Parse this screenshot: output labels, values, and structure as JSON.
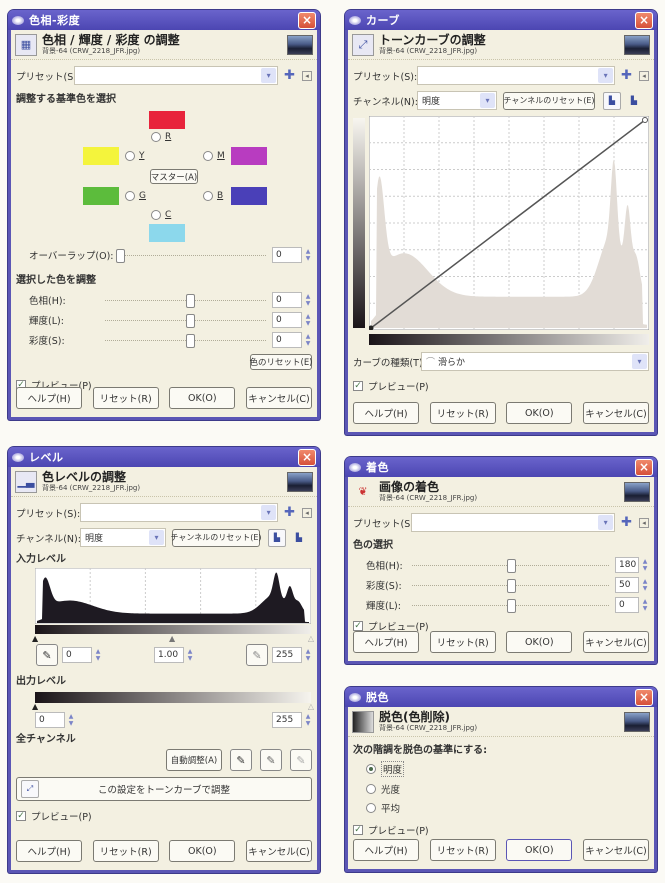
{
  "common": {
    "subtitle": "背景-64 (CRW_2218_JFR.jpg)",
    "preset_label": "プリセット(S):",
    "preset_value": "",
    "preview_label": "プレビュー(P)",
    "preview_checked": true,
    "buttons": {
      "help": "ヘルプ(H)",
      "reset": "リセット(R)",
      "ok": "OK(O)",
      "cancel": "キャンセル(C)"
    },
    "icons": {
      "close": "×",
      "dropdown": "▾",
      "add_preset": "✚",
      "menu": "◂",
      "checkmark": "✓",
      "spin_arrows": "▲▼"
    }
  },
  "hue_saturation": {
    "window_title": "色相-彩度",
    "header_title": "色相 / 輝度 / 彩度 の調整",
    "select_color_section": "調整する基準色を選択",
    "colors": {
      "R": {
        "label": "R",
        "color": "#e8243c"
      },
      "Y": {
        "label": "Y",
        "color": "#f4f43c"
      },
      "M": {
        "label": "M",
        "color": "#b83cc0"
      },
      "G": {
        "label": "G",
        "color": "#5cbc3c"
      },
      "B": {
        "label": "B",
        "color": "#4a40b8"
      },
      "C": {
        "label": "C",
        "color": "#8cd8ec"
      }
    },
    "master_button": "マスター(A)",
    "overlap_label": "オーバーラップ(O):",
    "overlap_value": "0",
    "adjust_section": "選択した色を調整",
    "sliders": [
      {
        "label": "色相(H):",
        "value": "0"
      },
      {
        "label": "輝度(L):",
        "value": "0"
      },
      {
        "label": "彩度(S):",
        "value": "0"
      }
    ],
    "reset_color_button": "色のリセット(E)"
  },
  "curves": {
    "window_title": "カーブ",
    "header_title": "トーンカーブの調整",
    "channel_label": "チャンネル(N):",
    "channel_value": "明度",
    "reset_channel_button": "チャンネルのリセット(E)",
    "curve_type_label": "カーブの種類(T):",
    "curve_type_value": "滑らか"
  },
  "levels": {
    "window_title": "レベル",
    "header_title": "色レベルの調整",
    "channel_label": "チャンネル(N):",
    "channel_value": "明度",
    "reset_channel_button": "チャンネルのリセット(E)",
    "input_section": "入力レベル",
    "input_low": "0",
    "input_gamma": "1.00",
    "input_high": "255",
    "output_section": "出力レベル",
    "output_low": "0",
    "output_high": "255",
    "all_channels_section": "全チャンネル",
    "auto_button": "自動調整(A)",
    "edit_curves_button": "この設定をトーンカーブで調整"
  },
  "colorize": {
    "window_title": "着色",
    "header_title": "画像の着色",
    "select_section": "色の選択",
    "sliders": [
      {
        "label": "色相(H):",
        "value": "180",
        "fraction": 0.5
      },
      {
        "label": "彩度(S):",
        "value": "50",
        "fraction": 0.5
      },
      {
        "label": "輝度(L):",
        "value": "0",
        "fraction": 0.5
      }
    ]
  },
  "desaturate": {
    "window_title": "脱色",
    "header_title": "脱色(色削除)",
    "section": "次の階調を脱色の基準にする:",
    "options": [
      {
        "label": "明度",
        "selected": true
      },
      {
        "label": "光度",
        "selected": false
      },
      {
        "label": "平均",
        "selected": false
      }
    ]
  }
}
